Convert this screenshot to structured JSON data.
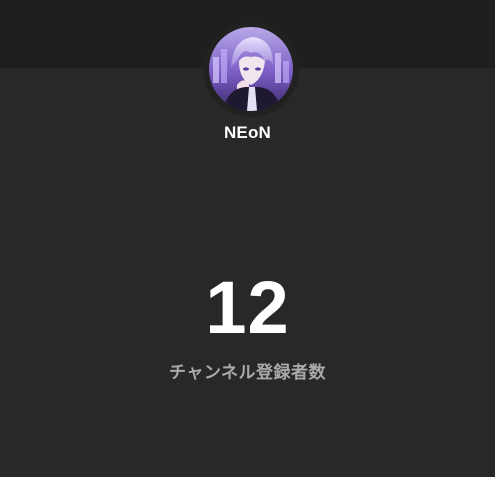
{
  "channel": {
    "name": "NEoN"
  },
  "stats": {
    "subscriber_count": "12",
    "subscriber_label": "チャンネル登録者数"
  },
  "colors": {
    "background": "#282828",
    "banner": "#1f1f1f",
    "text_primary": "#ffffff",
    "text_secondary": "#aaaaaa",
    "avatar_accent": "#8a6fd1"
  }
}
